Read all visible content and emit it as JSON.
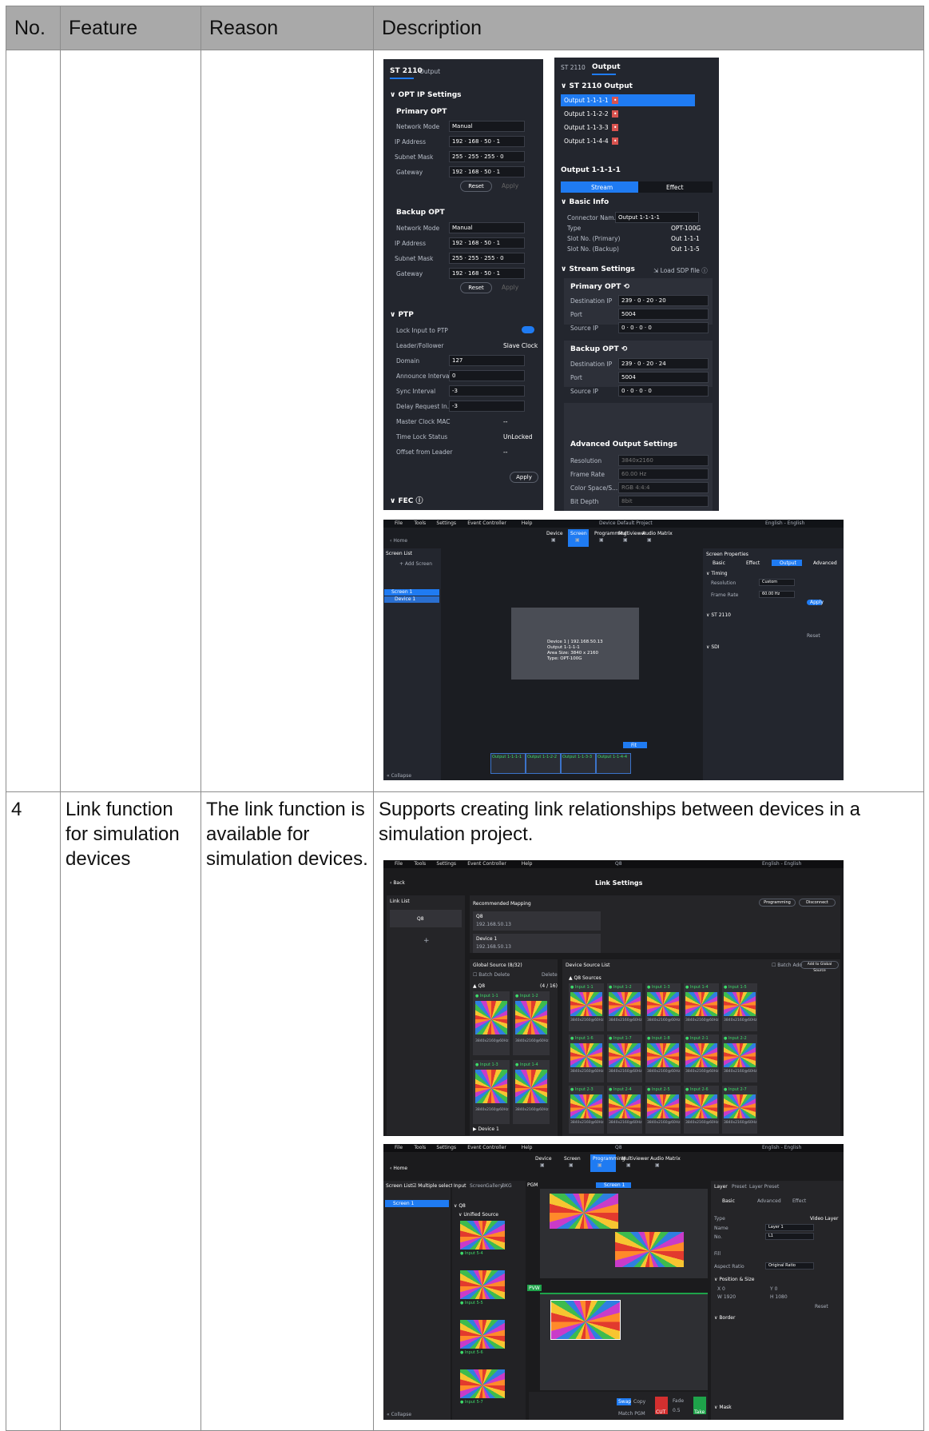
{
  "table": {
    "headers": [
      "No.",
      "Feature",
      "Reason",
      "Description"
    ],
    "row4": {
      "no": "4",
      "feature": "Link function for simulation devices",
      "reason": "The link function is available for simulation devices.",
      "description": "Supports creating link relationships between devices in a simulation project."
    }
  },
  "shot_opt": {
    "tabs": [
      "ST 2110",
      "Output"
    ],
    "section_opt": "OPT IP Settings",
    "primary": "Primary OPT",
    "backup": "Backup OPT",
    "network_mode_label": "Network Mode",
    "network_mode_value": "Manual",
    "ip_label": "IP Address",
    "subnet_label": "Subnet Mask",
    "gateway_label": "Gateway",
    "ip_value": "192 · 168 · 50 · 1",
    "subnet_value": "255 · 255 · 255 · 0",
    "gateway_value": "192 · 168 · 50 · 1",
    "reset": "Reset",
    "apply": "Apply",
    "ptp": "PTP",
    "ptp_rows": [
      {
        "label": "Lock Input to PTP",
        "value": ""
      },
      {
        "label": "Leader/Follower",
        "value": "Slave Clock"
      },
      {
        "label": "Domain",
        "value": "127"
      },
      {
        "label": "Announce Interval",
        "value": "0"
      },
      {
        "label": "Sync Interval",
        "value": "-3"
      },
      {
        "label": "Delay Request In...",
        "value": "-3"
      },
      {
        "label": "Master Clock MAC",
        "value": "--"
      },
      {
        "label": "Time Lock Status",
        "value": "UnLocked"
      },
      {
        "label": "Offset from Leader",
        "value": "--"
      }
    ],
    "fec": "FEC"
  },
  "shot_out": {
    "tabs": [
      "ST 2110",
      "Output"
    ],
    "section": "ST 2110 Output",
    "outputs": [
      "Output 1-1-1-1",
      "Output 1-1-2-2",
      "Output 1-1-3-3",
      "Output 1-1-4-4"
    ],
    "current": "Output 1-1-1-1",
    "stream_tab": "Stream",
    "effect_tab": "Effect",
    "basic_info": "Basic Info",
    "info": [
      {
        "label": "Connector Nam...",
        "value": "Output 1-1-1-1"
      },
      {
        "label": "Type",
        "value": "OPT-100G"
      },
      {
        "label": "Slot No. (Primary)",
        "value": "Out 1-1-1"
      },
      {
        "label": "Slot No. (Backup)",
        "value": "Out 1-1-5"
      }
    ],
    "stream_settings": "Stream Settings",
    "load_sdp": "Load SDP file",
    "primary": "Primary OPT",
    "backup": "Backup OPT",
    "dest_label": "Destination IP",
    "port_label": "Port",
    "src_label": "Source IP",
    "primary_dest": "239 · 0 · 20 · 20",
    "backup_dest": "239 · 0 · 20 · 24",
    "port": "5004",
    "src": "0 · 0 · 0 · 0",
    "advanced": "Advanced Output Settings",
    "adv": [
      {
        "label": "Resolution",
        "value": "3840x2160"
      },
      {
        "label": "Frame Rate",
        "value": "60.00 Hz"
      },
      {
        "label": "Color Space/S...",
        "value": "RGB 4:4:4"
      },
      {
        "label": "Bit Depth",
        "value": "8bit"
      }
    ]
  },
  "shot_screen": {
    "menu": [
      "File",
      "Tools",
      "Settings",
      "Event Controller",
      "Help"
    ],
    "title": "Device Default Project",
    "lang": "English - English",
    "home": "Home",
    "modes": [
      "Device",
      "Screen",
      "Programming",
      "Multiviewer",
      "Audio Matrix"
    ],
    "screen_list": "Screen List",
    "add_screen": "+ Add Screen",
    "screen_item": "Screen 1",
    "device_item": "Device 1",
    "properties": "Screen Properties",
    "prop_tabs": [
      "Basic",
      "Effect",
      "Output",
      "Advanced"
    ],
    "timing": "Timing",
    "resolution": "Resolution",
    "custom": "Custom",
    "frame_rate": "Frame Rate",
    "fr_value": "60.00 Hz",
    "apply": "Apply",
    "st2110": "ST 2110",
    "sdi": "SDI",
    "reset": "Reset",
    "card_lines": [
      "Device 1 | 192.168.50.13",
      "Output 1-1-1-1",
      "Area Size: 3840 x 2160",
      "Type: OPT-100G"
    ],
    "collapse": "Collapse",
    "fit": "Fit",
    "outputs": [
      "Output 1-1-1-1",
      "Output 1-1-2-2",
      "Output 1-1-3-3",
      "Output 1-1-4-4"
    ]
  },
  "shot_link": {
    "menu": [
      "File",
      "Tools",
      "Settings",
      "Event Controller",
      "Help"
    ],
    "app": "Q8",
    "lang": "English - English",
    "back": "Back",
    "title": "Link Settings",
    "link_list": "Link List",
    "device": "Q8",
    "recommended": "Recommended Mapping",
    "programming": "Programming",
    "disconnect": "Disconnect",
    "q8": "Q8",
    "q8_ip": "192.168.50.13",
    "dev1": "Device 1",
    "dev1_ip": "192.168.50.13",
    "global_source": "Global Source (8/32)",
    "batch_delete": "Batch Delete",
    "delete": "Delete",
    "group_q8": "Q8",
    "group_count": "(4 / 16)",
    "global_inputs": [
      "Input 1-1",
      "Input 1-2",
      "Input 1-3",
      "Input 1-4"
    ],
    "group_dev1": "Device 1",
    "device_source_list": "Device Source List",
    "batch_add": "Batch Add",
    "add_to_global": "Add to Global Source",
    "q8_sources": "Q8 Sources",
    "source_inputs": [
      "Input 1-1",
      "Input 1-2",
      "Input 1-3",
      "Input 1-4",
      "Input 1-5",
      "Input 1-6",
      "Input 1-7",
      "Input 1-8",
      "Input 2-1",
      "Input 2-2",
      "Input 2-3",
      "Input 2-4",
      "Input 2-5",
      "Input 2-6",
      "Input 2-7"
    ],
    "res": "3840x2160@60Hz"
  },
  "shot_prog": {
    "menu": [
      "File",
      "Tools",
      "Settings",
      "Event Controller",
      "Help"
    ],
    "app": "Q8",
    "lang": "English - English",
    "home": "Home",
    "modes": [
      "Device",
      "Screen",
      "Programming",
      "Multiviewer",
      "Audio Matrix"
    ],
    "screen_list": "Screen List",
    "multiple_select": "Multiple select",
    "screen_item": "Screen 1",
    "src_tabs": [
      "Input",
      "Screen",
      "Gallery",
      "BKG"
    ],
    "group": "Q8",
    "unified": "Unified Source",
    "inputs": [
      "Input 5-4",
      "Input 5-5",
      "Input 5-6",
      "Input 5-7"
    ],
    "pgm": "PGM",
    "pvw": "PVW",
    "screen_tag": "Screen 1",
    "layer_tabs": [
      "Layer",
      "Preset",
      "Layer Preset"
    ],
    "sub_tabs": [
      "Basic",
      "Advanced",
      "Effect"
    ],
    "type_label": "Type",
    "type_value": "Video Layer",
    "name_label": "Name",
    "name_value": "Layer 1",
    "no_label": "No.",
    "no_value": "L1",
    "fill": "Fill",
    "aspect": "Aspect Ratio",
    "aspect_value": "Original Ratio",
    "pos_size": "Position & Size",
    "x": "0",
    "y": "0",
    "w": "1920",
    "h": "1080",
    "reset": "Reset",
    "border": "Border",
    "mask": "Mask",
    "collapse": "Collapse",
    "take": "Take",
    "swap": "Swap",
    "copy": "Copy",
    "cut": "CUT",
    "fade": "Fade",
    "fade_val": "0.5",
    "match_pgm": "Match PGM"
  }
}
